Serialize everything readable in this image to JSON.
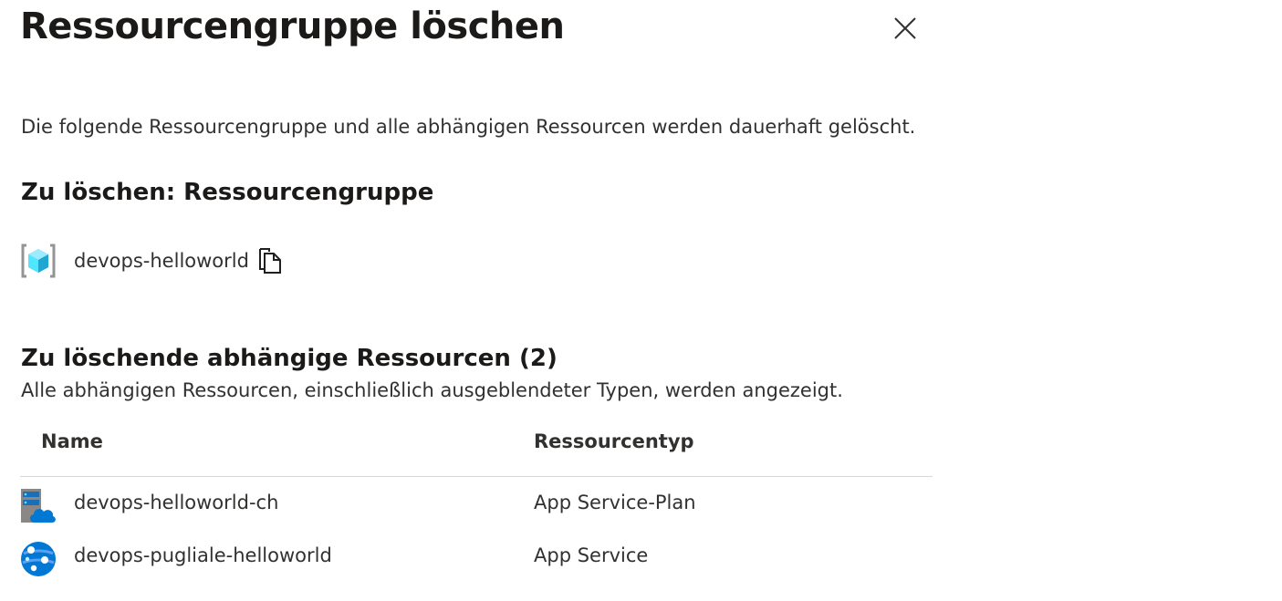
{
  "dialog": {
    "title": "Ressourcengruppe löschen",
    "close_icon": "close-icon",
    "description": "Die folgende Ressourcengruppe und alle abhängigen Ressourcen werden dauerhaft gelöscht."
  },
  "resource_group_section": {
    "heading": "Zu löschen: Ressourcengruppe",
    "resource_group": {
      "icon": "resource-group-icon",
      "name": "devops-helloworld",
      "copy_icon": "copy-icon"
    }
  },
  "dependent_section": {
    "heading": "Zu löschende abhängige Ressourcen (2)",
    "subtitle": "Alle abhängigen Ressourcen, einschließlich ausgeblendeter Typen, werden angezeigt.",
    "columns": {
      "name": "Name",
      "type": "Ressourcentyp"
    },
    "rows": [
      {
        "icon": "app-service-plan-icon",
        "name": "devops-helloworld-ch",
        "type": "App Service-Plan"
      },
      {
        "icon": "app-service-icon",
        "name": "devops-pugliale-helloworld",
        "type": "App Service"
      }
    ]
  },
  "colors": {
    "text": "#323130",
    "heading": "#1b1a19",
    "divider": "#d9d8d6",
    "azure_blue": "#0078d4",
    "cyan": "#50e6ff"
  }
}
